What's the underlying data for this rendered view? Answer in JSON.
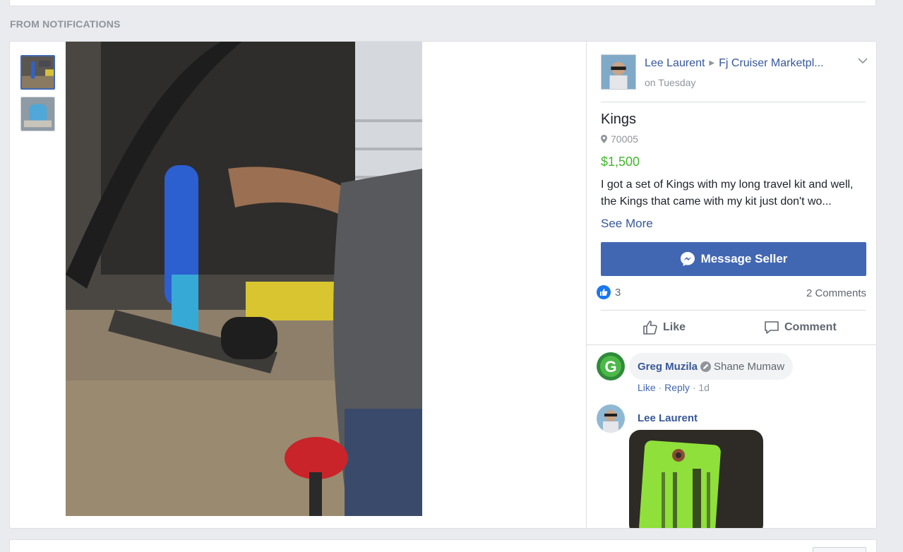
{
  "section_label": "FROM NOTIFICATIONS",
  "post": {
    "author": "Lee Laurent",
    "group": "Fj Cruiser Marketpl...",
    "time": "on Tuesday"
  },
  "listing": {
    "title": "Kings",
    "location": "70005",
    "price": "$1,500",
    "description": "I got a set of Kings with my long travel kit and well, the Kings that came with my kit just don't wo...",
    "see_more": "See More",
    "message_button": "Message Seller"
  },
  "stats": {
    "reaction_count": "3",
    "comments": "2 Comments"
  },
  "actions": {
    "like": "Like",
    "comment": "Comment"
  },
  "comment_1": {
    "author": "Greg Muzila",
    "tagged": "Shane Mumaw",
    "like": "Like",
    "reply": "Reply",
    "time": "1d",
    "separator": "·"
  },
  "comment_2": {
    "author": "Lee Laurent"
  },
  "icons": {
    "location": "map-pin-icon",
    "messenger": "messenger-icon",
    "like_reaction": "thumbs-up-reaction-icon",
    "like_action": "thumbs-up-outline-icon",
    "comment_action": "speech-bubble-icon",
    "menu": "chevron-down-icon",
    "tag": "pencil-tag-icon"
  },
  "colors": {
    "link": "#365899",
    "price": "#42b72a",
    "button": "#4267b2",
    "background": "#e9ebee"
  }
}
